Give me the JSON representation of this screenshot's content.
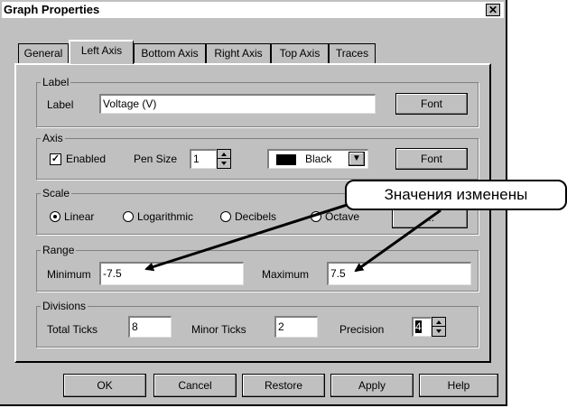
{
  "window": {
    "title": "Graph Properties",
    "close_label": "✕"
  },
  "tabs": [
    {
      "label": "General"
    },
    {
      "label": "Left Axis"
    },
    {
      "label": "Bottom Axis"
    },
    {
      "label": "Right Axis"
    },
    {
      "label": "Top Axis"
    },
    {
      "label": "Traces"
    }
  ],
  "label_group": {
    "title": "Label",
    "field_label": "Label",
    "value": "Voltage (V)",
    "font_button": "Font"
  },
  "axis_group": {
    "title": "Axis",
    "enabled_label": "Enabled",
    "enabled": true,
    "pen_size_label": "Pen Size",
    "pen_size": "1",
    "color_label": "Black",
    "color_swatch": "#000000",
    "font_button": "Font"
  },
  "scale_group": {
    "title": "Scale",
    "options": [
      "Linear",
      "Logarithmic",
      "Decibels",
      "Octave"
    ],
    "selected": "Linear",
    "extra_button": "..."
  },
  "range_group": {
    "title": "Range",
    "minimum_label": "Minimum",
    "minimum": "-7.5",
    "maximum_label": "Maximum",
    "maximum": "7.5"
  },
  "divisions_group": {
    "title": "Divisions",
    "total_ticks_label": "Total Ticks",
    "total_ticks": "8",
    "minor_ticks_label": "Minor Ticks",
    "minor_ticks": "2",
    "precision_label": "Precision",
    "precision": "4"
  },
  "buttons": {
    "ok": "OK",
    "cancel": "Cancel",
    "restore": "Restore",
    "apply": "Apply",
    "help": "Help"
  },
  "annotation": {
    "text": "Значения изменены"
  }
}
